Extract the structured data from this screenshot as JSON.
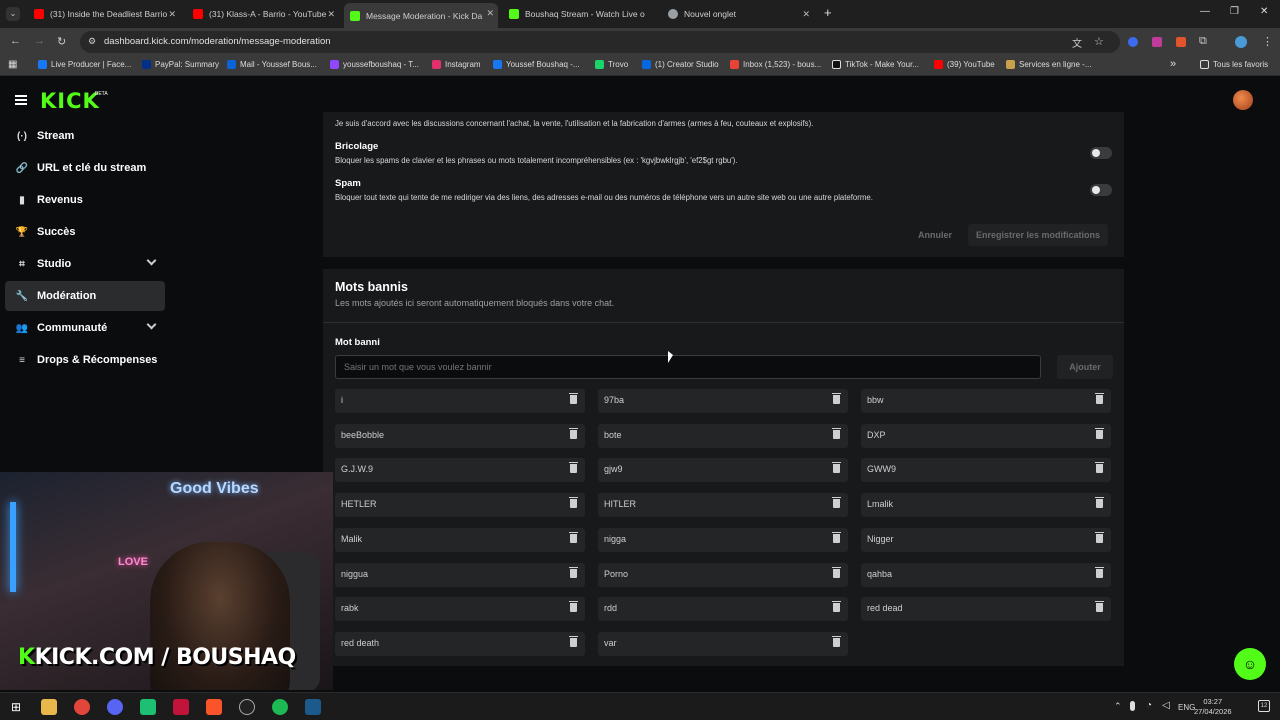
{
  "browser": {
    "tabs": [
      {
        "title": "(31) Inside the Deadliest Barrio",
        "icon": "youtube-icon"
      },
      {
        "title": "(31) Klass-A - Barrio - YouTube",
        "icon": "youtube-icon"
      },
      {
        "title": "Message Moderation - Kick Da",
        "icon": "kick-icon"
      },
      {
        "title": "Boushaq Stream - Watch Live o",
        "icon": "kick-icon"
      },
      {
        "title": "Nouvel onglet",
        "icon": "chrome-icon"
      }
    ],
    "new_tab": "+",
    "url": "dashboard.kick.com/moderation/message-moderation",
    "bookmarks": [
      "Live Producer | Face...",
      "PayPal: Summary",
      "Mail - Youssef Bous...",
      "youssefboushaq - T...",
      "Instagram",
      "Youssef Boushaq -...",
      "Trovo",
      "(1) Creator Studio",
      "Inbox (1,523) - bous...",
      "TikTok - Make Your...",
      "(39) YouTube",
      "Services en ligne -..."
    ],
    "all_bookmarks": "Tous les favoris",
    "more_bookmarks": "»"
  },
  "kick": {
    "logo": "KICK",
    "beta": "BETA"
  },
  "sidebar": {
    "items": [
      {
        "label": "Stream",
        "icon": "(·)"
      },
      {
        "label": "URL et clé du stream",
        "icon": "🔗"
      },
      {
        "label": "Revenus",
        "icon": "▮"
      },
      {
        "label": "Succès",
        "icon": "🏆"
      },
      {
        "label": "Studio",
        "icon": "⌗"
      },
      {
        "label": "Modération",
        "icon": "🔧"
      },
      {
        "label": "Communauté",
        "icon": "👥"
      },
      {
        "label": "Drops & Récompenses",
        "icon": "≡"
      }
    ]
  },
  "filters": {
    "top_cut_text": "Je suis d'accord avec les discussions concernant l'achat, la vente, l'utilisation et la fabrication d'armes (armes à feu, couteaux et explosifs).",
    "bricolage_title": "Bricolage",
    "bricolage_desc": "Bloquer les spams de clavier et les phrases ou mots totalement incompréhensibles (ex : 'kgvjbwklrgjb', 'ef2$gt rgbu').",
    "spam_title": "Spam",
    "spam_desc": "Bloquer tout texte qui tente de me rediriger via des liens, des adresses e-mail ou des numéros de téléphone vers un autre site web ou une autre plateforme.",
    "cancel": "Annuler",
    "save": "Enregistrer les modifications"
  },
  "banned": {
    "title": "Mots bannis",
    "subtitle": "Les mots ajoutés ici seront automatiquement bloqués dans votre chat.",
    "label": "Mot banni",
    "placeholder": "Saisir un mot que vous voulez bannir",
    "add": "Ajouter",
    "words": [
      "i",
      "97ba",
      "bbw",
      "beeBobble",
      "bote",
      "DXP",
      "G.J.W.9",
      "gjw9",
      "GWW9",
      "HETLER",
      "HITLER",
      "Lmalik",
      "Malik",
      "nigga",
      "Nigger",
      "niggua",
      "Porno",
      "qahba",
      "rabk",
      "rdd",
      "red dead",
      "red death",
      "var"
    ]
  },
  "overlay": {
    "neon_sign": "Good Vibes",
    "love_sign": "LOVE",
    "channel_k": "K",
    "channel": "KICK.COM / BOUSHAQ"
  },
  "taskbar": {
    "lang": "ENG",
    "time": "03:27",
    "date": "27/04/2026",
    "notif": "12"
  },
  "colors": {
    "kick_green": "#53fc18",
    "panel": "#18191b",
    "background": "#0b0c0d"
  }
}
